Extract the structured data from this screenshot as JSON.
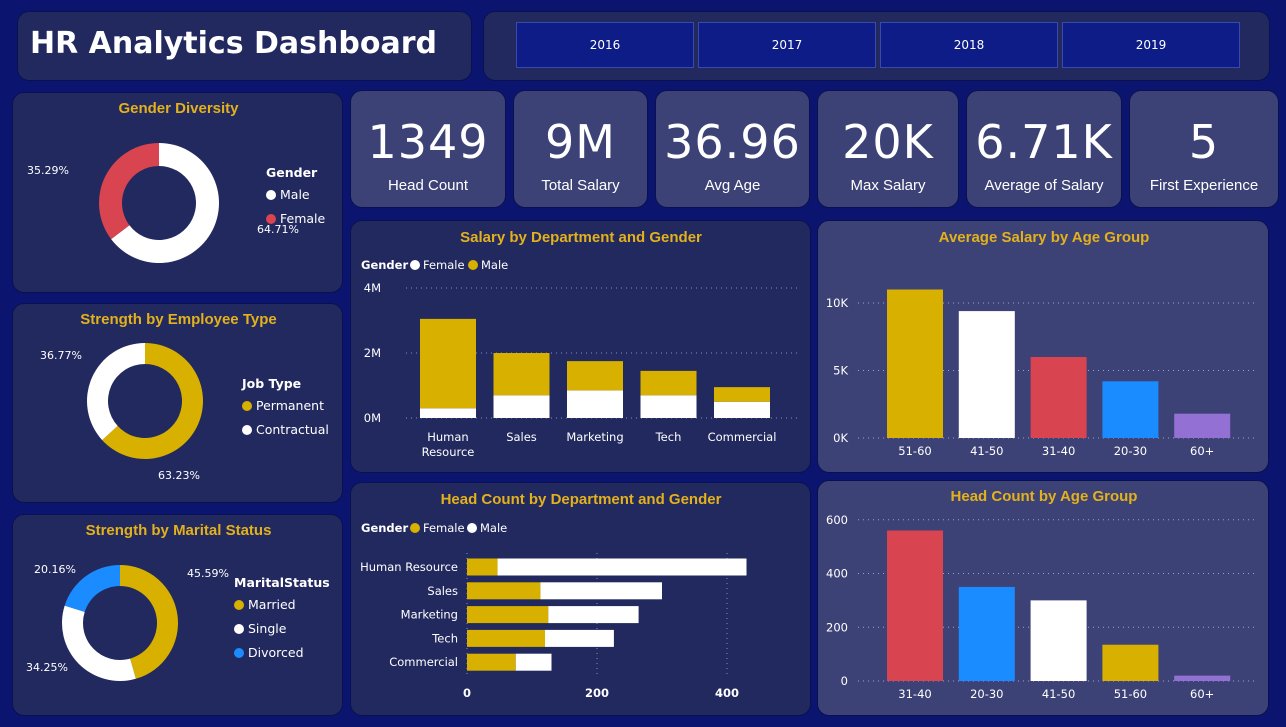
{
  "header": {
    "title": "HR Analytics Dashboard",
    "years": [
      "2016",
      "2017",
      "2018",
      "2019"
    ]
  },
  "kpis": [
    {
      "value": "1349",
      "label": "Head Count"
    },
    {
      "value": "9M",
      "label": "Total Salary"
    },
    {
      "value": "36.96",
      "label": "Avg Age"
    },
    {
      "value": "20K",
      "label": "Max Salary"
    },
    {
      "value": "6.71K",
      "label": "Average of Salary"
    },
    {
      "value": "5",
      "label": "First Experience"
    }
  ],
  "colors": {
    "gold": "#d7b000",
    "white": "#ffffff",
    "red": "#d84450",
    "blue": "#1a8cff",
    "purple": "#9370d4",
    "title": "#e2b11c"
  },
  "chart_data": [
    {
      "id": "gender_diversity",
      "type": "pie",
      "title": "Gender Diversity",
      "legend_title": "Gender",
      "labels": [
        "Male",
        "Female"
      ],
      "values": [
        64.71,
        35.29
      ],
      "value_labels": [
        "64.71%",
        "35.29%"
      ],
      "colors": [
        "#ffffff",
        "#d84450"
      ]
    },
    {
      "id": "employee_type",
      "type": "pie",
      "title": "Strength by Employee Type",
      "legend_title": "Job Type",
      "labels": [
        "Permanent",
        "Contractual"
      ],
      "values": [
        63.23,
        36.77
      ],
      "value_labels": [
        "63.23%",
        "36.77%"
      ],
      "colors": [
        "#d7b000",
        "#ffffff"
      ]
    },
    {
      "id": "marital_status",
      "type": "pie",
      "title": "Strength by Marital Status",
      "legend_title": "MaritalStatus",
      "labels": [
        "Married",
        "Single",
        "Divorced"
      ],
      "values": [
        45.59,
        34.25,
        20.16
      ],
      "value_labels": [
        "45.59%",
        "34.25%",
        "20.16%"
      ],
      "colors": [
        "#d7b000",
        "#ffffff",
        "#1a8cff"
      ]
    },
    {
      "id": "salary_dept_gender",
      "type": "bar",
      "stacked": true,
      "title": "Salary by Department and Gender",
      "legend_title": "Gender",
      "categories": [
        "Human Resource",
        "Sales",
        "Marketing",
        "Tech",
        "Commercial"
      ],
      "series": [
        {
          "name": "Female",
          "color": "#ffffff",
          "values": [
            0.3,
            0.7,
            0.85,
            0.7,
            0.5
          ]
        },
        {
          "name": "Male",
          "color": "#d7b000",
          "values": [
            2.75,
            1.3,
            0.9,
            0.75,
            0.45
          ]
        }
      ],
      "ylim": [
        0,
        4
      ],
      "yticks": [
        0,
        2,
        4
      ],
      "ytick_labels": [
        "0M",
        "2M",
        "4M"
      ]
    },
    {
      "id": "avg_salary_age",
      "type": "bar",
      "title": "Average Salary by Age Group",
      "categories": [
        "51-60",
        "41-50",
        "31-40",
        "20-30",
        "60+"
      ],
      "values": [
        11000,
        9400,
        6000,
        4200,
        1800
      ],
      "colors": [
        "#d7b000",
        "#ffffff",
        "#d84450",
        "#1a8cff",
        "#9370d4"
      ],
      "ylim": [
        0,
        12000
      ],
      "yticks": [
        0,
        5000,
        10000
      ],
      "ytick_labels": [
        "0K",
        "5K",
        "10K"
      ]
    },
    {
      "id": "headcount_dept_gender",
      "type": "bar",
      "orientation": "horizontal",
      "stacked": true,
      "title": "Head Count by Department and Gender",
      "legend_title": "Gender",
      "categories": [
        "Human Resource",
        "Sales",
        "Marketing",
        "Tech",
        "Commercial"
      ],
      "series": [
        {
          "name": "Female",
          "color": "#d7b000",
          "values": [
            47,
            113,
            125,
            120,
            75
          ]
        },
        {
          "name": "Male",
          "color": "#ffffff",
          "values": [
            383,
            187,
            139,
            106,
            55
          ]
        }
      ],
      "xlim": [
        0,
        440
      ],
      "xticks": [
        0,
        200,
        400
      ],
      "xtick_labels": [
        "0",
        "200",
        "400"
      ]
    },
    {
      "id": "headcount_age",
      "type": "bar",
      "title": "Head Count by Age Group",
      "categories": [
        "31-40",
        "20-30",
        "41-50",
        "51-60",
        "60+"
      ],
      "values": [
        560,
        350,
        300,
        135,
        20
      ],
      "colors": [
        "#d84450",
        "#1a8cff",
        "#ffffff",
        "#d7b000",
        "#9370d4"
      ],
      "ylim": [
        0,
        640
      ],
      "yticks": [
        0,
        200,
        400,
        600
      ],
      "ytick_labels": [
        "0",
        "200",
        "400",
        "600"
      ]
    }
  ]
}
